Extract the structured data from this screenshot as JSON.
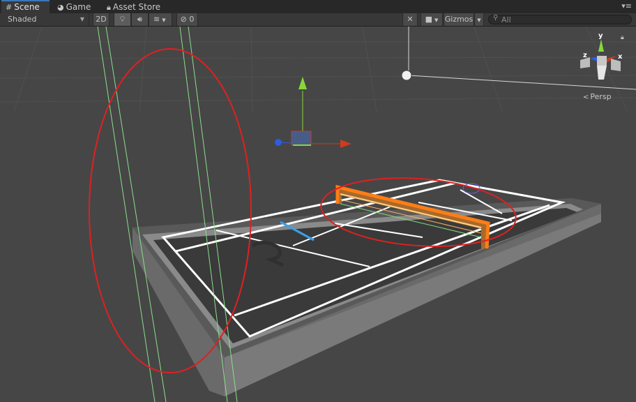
{
  "tabs": [
    {
      "label": "Scene",
      "icon": "hash-grid-icon",
      "active": true
    },
    {
      "label": "Game",
      "icon": "pacman-icon",
      "active": false
    },
    {
      "label": "Asset Store",
      "icon": "lock-bag-icon",
      "active": false
    }
  ],
  "toolbar": {
    "draw_mode": "Shaded",
    "mode_2d": "2D",
    "hidden_count": "0",
    "gizmos_label": "Gizmos",
    "search_placeholder": "All"
  },
  "gizmo": {
    "persp_label": "Persp",
    "axis_y": "y",
    "axis_z": "z",
    "axis_x": "x"
  },
  "colors": {
    "tab_accent": "#3a79bb",
    "selection_orange": "#ff7d17",
    "annotation_red": "#e02020",
    "collider_green": "#7fe07f",
    "handle_red": "#d03a1e",
    "handle_green": "#86d83a",
    "handle_blue": "#2f5de0"
  }
}
